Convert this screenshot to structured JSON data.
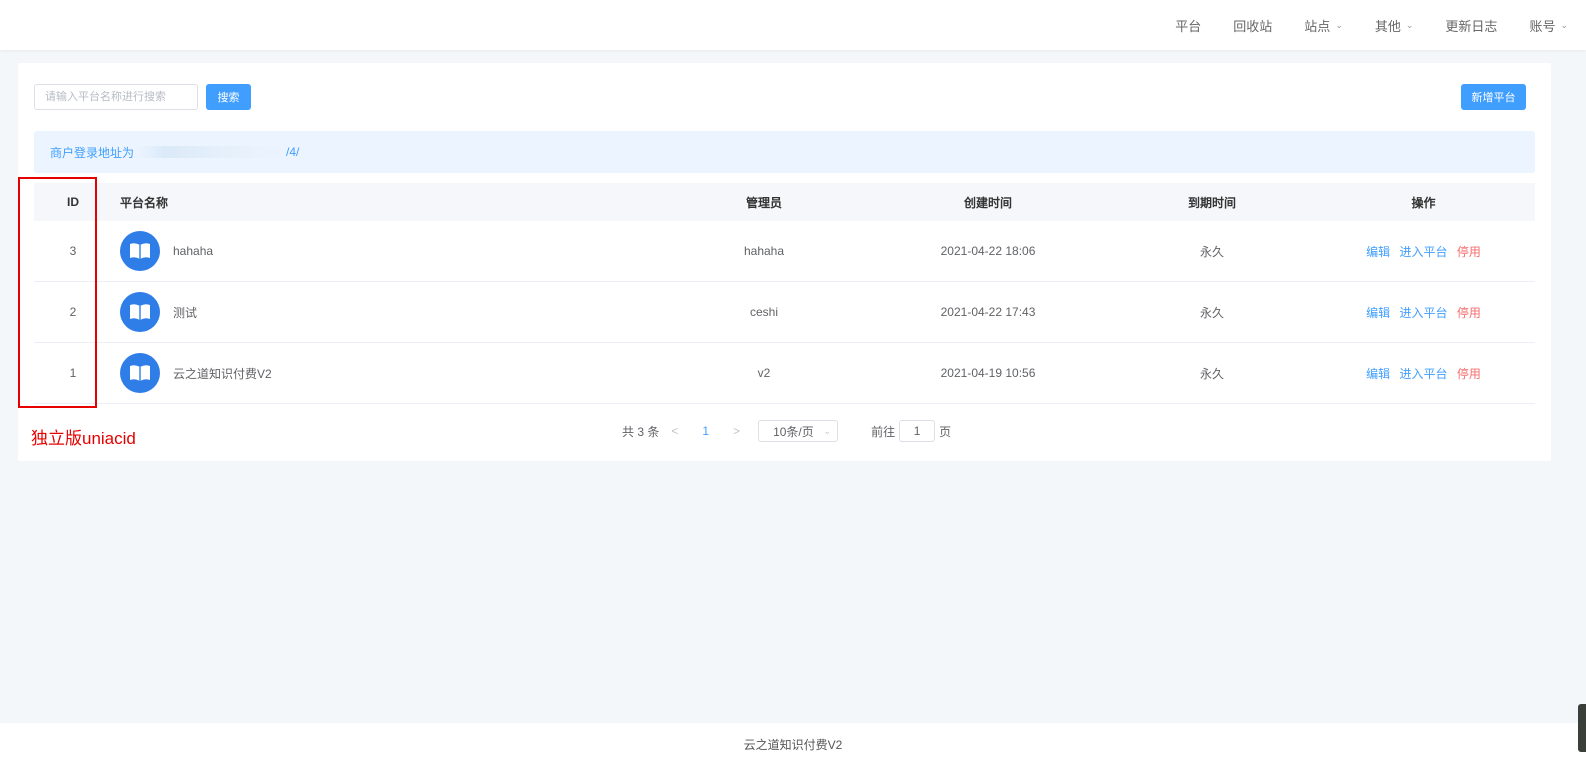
{
  "nav": {
    "items": [
      {
        "label": "平台",
        "dropdown": false
      },
      {
        "label": "回收站",
        "dropdown": false
      },
      {
        "label": "站点",
        "dropdown": true
      },
      {
        "label": "其他",
        "dropdown": true
      },
      {
        "label": "更新日志",
        "dropdown": false
      },
      {
        "label": "账号",
        "dropdown": true
      }
    ]
  },
  "toolbar": {
    "search_placeholder": "请输入平台名称进行搜索",
    "search_value": "",
    "search_button": "搜索",
    "add_button": "新增平台"
  },
  "notice": {
    "prefix": "商户登录地址为",
    "suffix": "/4/"
  },
  "table": {
    "headers": {
      "id": "ID",
      "name": "平台名称",
      "admin": "管理员",
      "created": "创建时间",
      "expire": "到期时间",
      "ops": "操作"
    },
    "rows": [
      {
        "id": "3",
        "name": "hahaha",
        "admin": "hahaha",
        "created": "2021-04-22 18:06",
        "expire": "永久"
      },
      {
        "id": "2",
        "name": "测试",
        "admin": "ceshi",
        "created": "2021-04-22 17:43",
        "expire": "永久"
      },
      {
        "id": "1",
        "name": "云之道知识付费V2",
        "admin": "v2",
        "created": "2021-04-19 10:56",
        "expire": "永久"
      }
    ],
    "ops": {
      "edit": "编辑",
      "enter": "进入平台",
      "disable": "停用"
    }
  },
  "annotation": {
    "label": "独立版uniacid",
    "color": "#e60000"
  },
  "pagination": {
    "total_text": "共 3 条",
    "current_page": "1",
    "page_size": "10条/页",
    "goto_prefix": "前往",
    "goto_value": "1",
    "goto_suffix": "页"
  },
  "footer": {
    "text": "云之道知识付费V2"
  },
  "colors": {
    "primary": "#409eff",
    "danger": "#f56c6c",
    "avatar": "#2f7ee8",
    "background": "#f4f7fa"
  }
}
